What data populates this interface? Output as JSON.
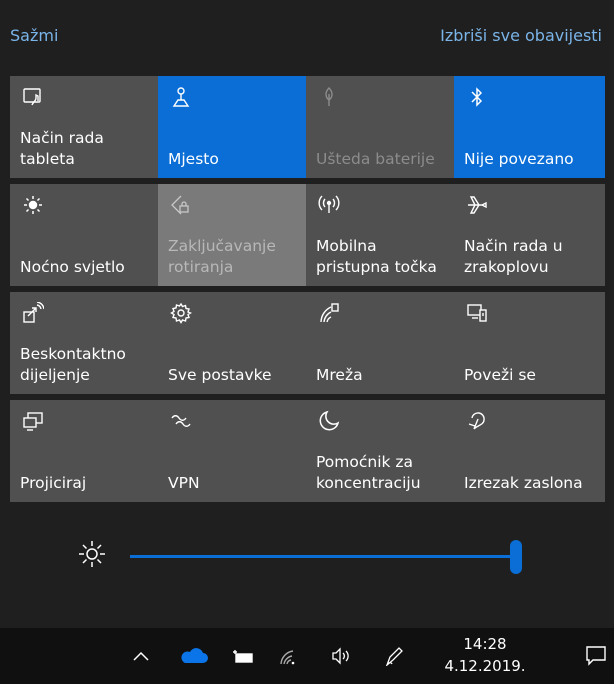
{
  "header": {
    "collapse_label": "Sažmi",
    "clear_label": "Izbriši sve obavijesti"
  },
  "tiles": [
    {
      "label": "Način rada\ntableta",
      "icon": "tablet-mode-icon",
      "state": "off"
    },
    {
      "label": "Mjesto",
      "icon": "location-icon",
      "state": "on"
    },
    {
      "label": "Ušteda baterije",
      "icon": "battery-saver-icon",
      "state": "disabled"
    },
    {
      "label": "Nije povezano",
      "icon": "bluetooth-icon",
      "state": "on"
    },
    {
      "label": "Noćno svjetlo",
      "icon": "night-light-icon",
      "state": "off"
    },
    {
      "label": "Zaključavanje\nrotiranja",
      "icon": "rotation-lock-icon",
      "state": "disabled"
    },
    {
      "label": "Mobilna\npristupna točka",
      "icon": "mobile-hotspot-icon",
      "state": "off"
    },
    {
      "label": "Način rada u\nzrakoplovu",
      "icon": "airplane-mode-icon",
      "state": "off"
    },
    {
      "label": "Beskontaktno\ndijeljenje",
      "icon": "nearby-sharing-icon",
      "state": "off"
    },
    {
      "label": "Sve postavke",
      "icon": "settings-gear-icon",
      "state": "off"
    },
    {
      "label": "Mreža",
      "icon": "network-icon",
      "state": "off"
    },
    {
      "label": "Poveži se",
      "icon": "connect-icon",
      "state": "off"
    },
    {
      "label": "Projiciraj",
      "icon": "project-icon",
      "state": "off"
    },
    {
      "label": "VPN",
      "icon": "vpn-icon",
      "state": "off"
    },
    {
      "label": "Pomoćnik za\nkoncentraciju",
      "icon": "focus-assist-moon-icon",
      "state": "off"
    },
    {
      "label": "Izrezak zaslona",
      "icon": "snip-icon",
      "state": "off"
    }
  ],
  "brightness": {
    "icon": "brightness-sun-icon",
    "level": 1.0
  },
  "colors": {
    "accent": "#0a6ed6",
    "tile_off": "#505050",
    "link": "#7ab4e8"
  },
  "taskbar": {
    "icons": [
      "chevron-up-icon",
      "onedrive-cloud-icon",
      "battery-icon",
      "wifi-icon",
      "volume-icon",
      "pen-icon"
    ],
    "time": "14:28",
    "date": "4.12.2019.",
    "notification_icon": "action-center-icon"
  }
}
